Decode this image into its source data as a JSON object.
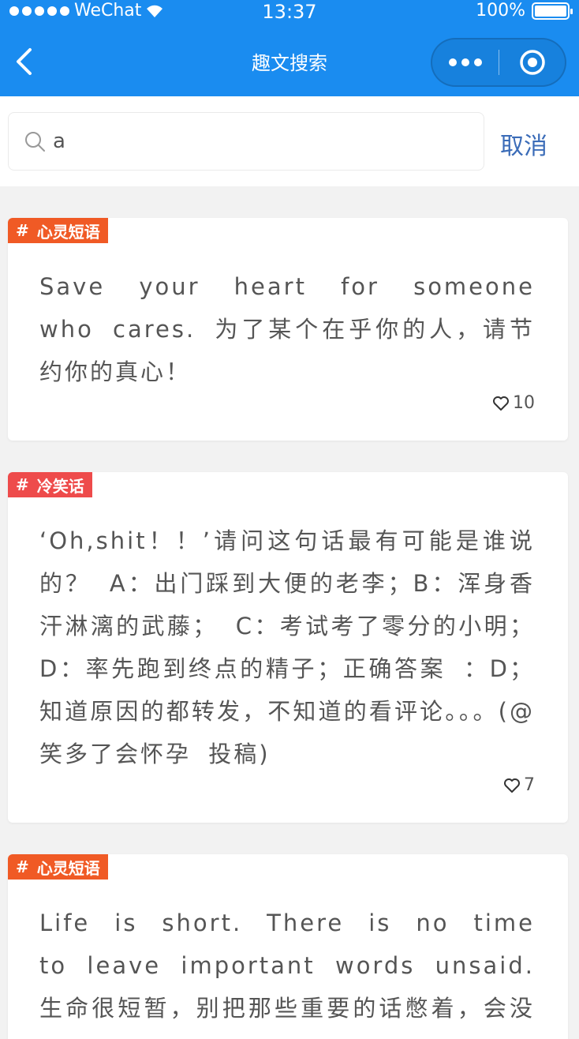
{
  "status_bar": {
    "carrier": "WeChat",
    "time": "13:37",
    "battery": "100%"
  },
  "nav": {
    "title": "趣文搜索"
  },
  "search": {
    "value": "a",
    "cancel_label": "取消"
  },
  "cards": [
    {
      "tag": "心灵短语",
      "content": "Save your heart for someone who cares. 为了某个在乎你的人，请节约你的真心！",
      "likes": "10"
    },
    {
      "tag": "冷笑话",
      "content": "‘Oh,shit！！’请问这句话最有可能是谁说的？ A：出门踩到大便的老李；B：浑身香汗淋漓的武藤； C：考试考了零分的小明；D：率先跑到终点的精子；正确答案 ：D；知道原因的都转发，不知道的看评论。。。(@笑多了会怀孕 投稿)",
      "likes": "7"
    },
    {
      "tag": "心灵短语",
      "content": "Life is short. There is no time to leave important words unsaid. 生命很短暂，别把那些重要的话憋着，会没有时间的哦！"
    }
  ],
  "tag_symbol": "#",
  "colors": {
    "header": "#1a8cf0",
    "tag_orange": "#f05a25",
    "tag_red": "#ee4b4b",
    "cancel": "#3b6cb8"
  }
}
